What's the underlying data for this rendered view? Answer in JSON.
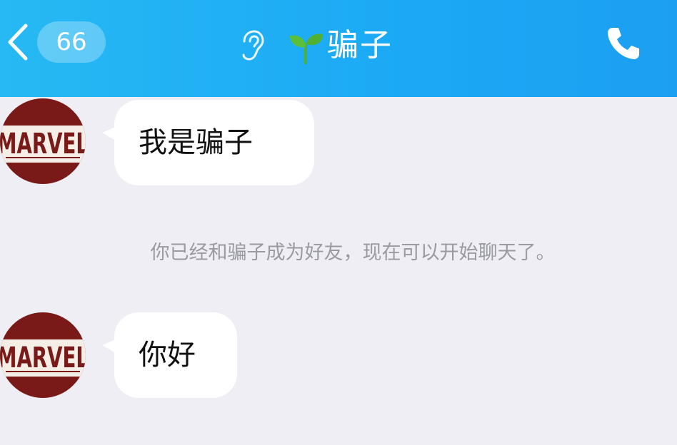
{
  "header": {
    "unread_badge": "66",
    "title": "骗子",
    "icons": [
      "back-chevron-icon",
      "ear-icon",
      "sprout-icon",
      "phone-icon"
    ],
    "background_color": "#1eaaf4"
  },
  "messages": [
    {
      "sender": "contact",
      "avatar": "MARVEL",
      "text": "我是骗子"
    },
    {
      "sender": "contact",
      "avatar": "MARVEL",
      "text": "你好"
    }
  ],
  "system_message": "你已经和骗子成为好友，现在可以开始聊天了。",
  "colors": {
    "chat_background": "#eeeef4",
    "bubble": "#ffffff",
    "avatar_red": "#7a1a18"
  }
}
